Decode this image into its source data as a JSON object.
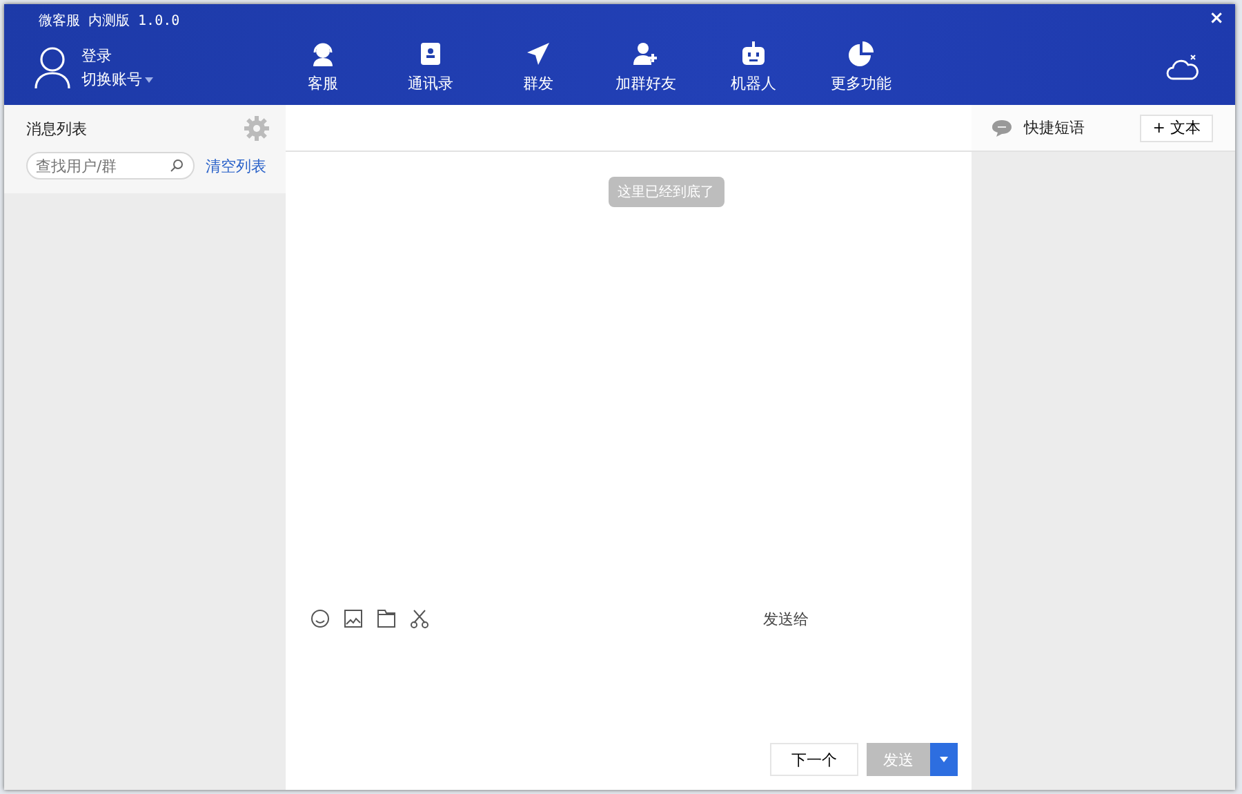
{
  "window": {
    "title": "微客服 内测版 1.0.0",
    "close": "×"
  },
  "account": {
    "login": "登录",
    "switch": "切换账号"
  },
  "nav": [
    {
      "label": "客服"
    },
    {
      "label": "通讯录"
    },
    {
      "label": "群发"
    },
    {
      "label": "加群好友"
    },
    {
      "label": "机器人"
    },
    {
      "label": "更多功能"
    }
  ],
  "sidebar": {
    "title": "消息列表",
    "search": {
      "placeholder": "查找用户/群"
    },
    "clear": "清空列表"
  },
  "chat": {
    "notice": "这里已经到底了",
    "send_to": "发送给",
    "next": "下一个",
    "send": {
      "label": "发送",
      "disabled": true
    }
  },
  "quick": {
    "title": "快捷短语",
    "add": "+ 文本"
  }
}
